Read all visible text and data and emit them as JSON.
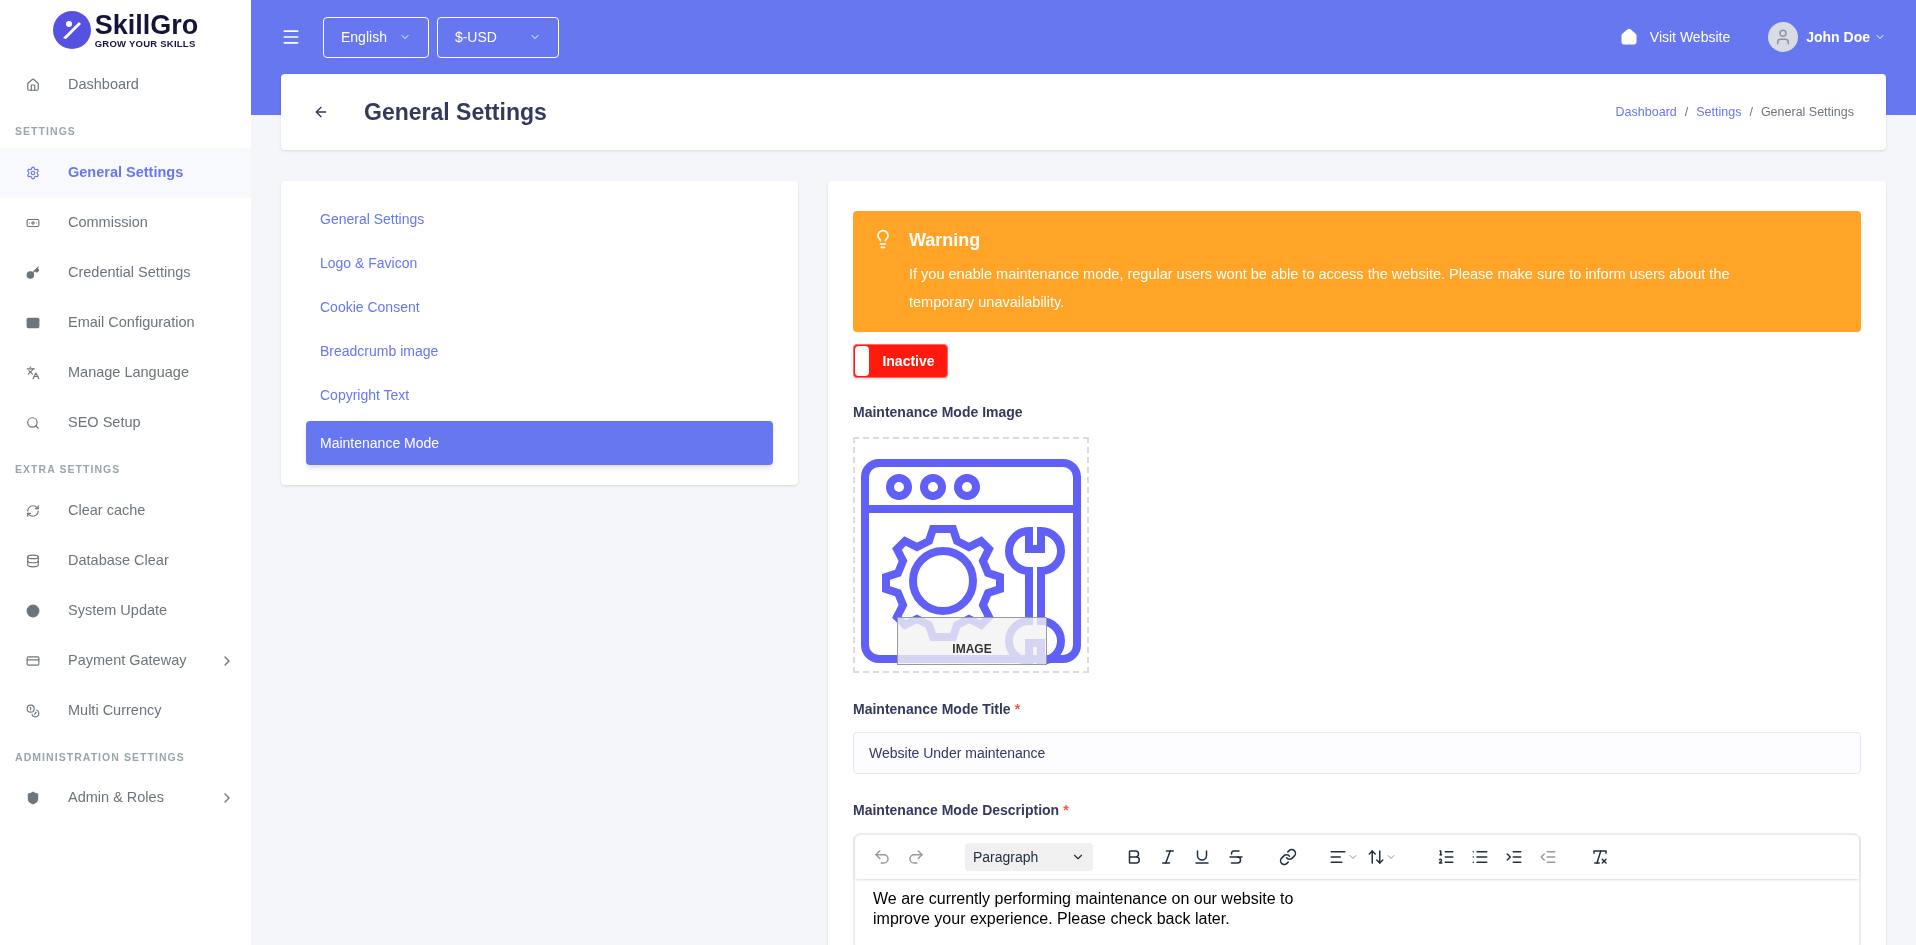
{
  "brand": {
    "name": "SkillGro",
    "tagline": "GROW YOUR SKILLS"
  },
  "sidebar": {
    "top_items": [
      {
        "label": "Dashboard",
        "selected": false,
        "expandable": false
      }
    ],
    "sections": [
      {
        "title": "SETTINGS",
        "items": [
          {
            "label": "General Settings",
            "selected": true,
            "expandable": false
          },
          {
            "label": "Commission",
            "selected": false,
            "expandable": false
          },
          {
            "label": "Credential Settings",
            "selected": false,
            "expandable": false
          },
          {
            "label": "Email Configuration",
            "selected": false,
            "expandable": false
          },
          {
            "label": "Manage Language",
            "selected": false,
            "expandable": false
          },
          {
            "label": "SEO Setup",
            "selected": false,
            "expandable": false
          }
        ]
      },
      {
        "title": "EXTRA SETTINGS",
        "items": [
          {
            "label": "Clear cache",
            "selected": false,
            "expandable": false
          },
          {
            "label": "Database Clear",
            "selected": false,
            "expandable": false
          },
          {
            "label": "System Update",
            "selected": false,
            "expandable": false
          },
          {
            "label": "Payment Gateway",
            "selected": false,
            "expandable": true
          },
          {
            "label": "Multi Currency",
            "selected": false,
            "expandable": false
          }
        ]
      },
      {
        "title": "ADMINISTRATION SETTINGS",
        "items": [
          {
            "label": "Admin & Roles",
            "selected": false,
            "expandable": true
          }
        ]
      }
    ]
  },
  "topbar": {
    "language": "English",
    "currency": "$-USD",
    "visit_link": "Visit Website",
    "user": "John Doe"
  },
  "page_header": {
    "title": "General Settings",
    "breadcrumbs": [
      {
        "label": "Dashboard",
        "link": true
      },
      {
        "label": "Settings",
        "link": true
      },
      {
        "label": "General Settings",
        "link": false
      }
    ],
    "separator": "/"
  },
  "settings_menu": [
    {
      "label": "General Settings",
      "selected": false
    },
    {
      "label": "Logo & Favicon",
      "selected": false
    },
    {
      "label": "Cookie Consent",
      "selected": false
    },
    {
      "label": "Breadcrumb image",
      "selected": false
    },
    {
      "label": "Copyright Text",
      "selected": false
    },
    {
      "label": "Maintenance Mode",
      "selected": true
    }
  ],
  "warning": {
    "title": "Warning",
    "text": "If you enable maintenance mode, regular users wont be able to access the website. Please make sure to inform users about the temporary unavailability."
  },
  "status_toggle": {
    "label": "Inactive",
    "on": false
  },
  "image_field": {
    "label": "Maintenance Mode Image",
    "overlay": "IMAGE"
  },
  "title_field": {
    "label": "Maintenance Mode Title",
    "required_mark": "*",
    "value": "Website Under maintenance"
  },
  "description_field": {
    "label": "Maintenance Mode Description",
    "required_mark": "*",
    "block_format": "Paragraph",
    "content": "We are currently performing maintenance on our website to improve your experience. Please check back later."
  }
}
